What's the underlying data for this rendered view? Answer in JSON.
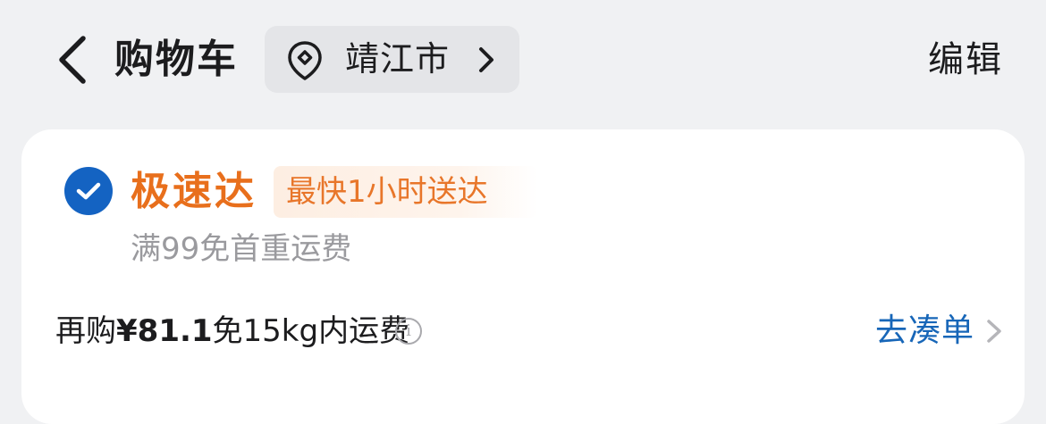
{
  "header": {
    "title": "购物车",
    "location": "靖江市",
    "edit_label": "编辑"
  },
  "store": {
    "name": "极速达",
    "tag": "最快1小时送达",
    "shipping_note": "满99免首重运费",
    "selected": true
  },
  "promo": {
    "prefix": "再购",
    "amount": "¥81.1",
    "suffix": "免15kg内运费",
    "info_icon": "i",
    "action_label": "去凑单"
  },
  "colors": {
    "accent_blue": "#1463c2",
    "express_orange": "#e86f1c",
    "link_blue": "#1766b8"
  }
}
